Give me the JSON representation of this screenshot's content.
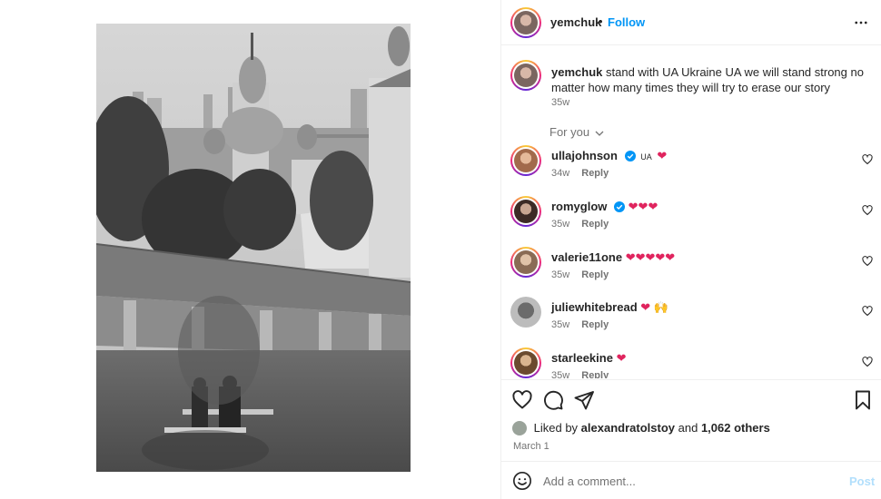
{
  "post": {
    "username": "yemchuk",
    "follow_label": "Follow",
    "dot": "•",
    "caption_user": "yemchuk",
    "caption_body": "stand with UA Ukraine UA we will stand strong no matter how many times they will try to erase our story",
    "caption_time": "35w"
  },
  "for_you_label": "For you",
  "comments": [
    {
      "user": "ullajohnson",
      "verified": true,
      "text_prefix": "UA",
      "hearts": "❤",
      "time": "34w",
      "reply": "Reply"
    },
    {
      "user": "romyglow",
      "verified": true,
      "text_prefix": "",
      "hearts": "❤❤❤",
      "time": "35w",
      "reply": "Reply"
    },
    {
      "user": "valerie11one",
      "verified": false,
      "text_prefix": "",
      "hearts": "❤❤❤❤❤",
      "time": "35w",
      "reply": "Reply"
    },
    {
      "user": "juliewhitebread",
      "verified": false,
      "text_prefix": "",
      "hearts": "❤",
      "extra_emoji": "🙌",
      "time": "35w",
      "reply": "Reply"
    },
    {
      "user": "starleekine",
      "verified": false,
      "text_prefix": "",
      "hearts": "❤",
      "time": "35w",
      "reply": "Reply"
    }
  ],
  "likes": {
    "prefix": "Liked by",
    "user": "alexandratolstoy",
    "joiner": "and",
    "others": "1,062 others"
  },
  "date": "March 1",
  "comment_box": {
    "placeholder": "Add a comment...",
    "post_label": "Post"
  },
  "icons": {
    "more": "more-horizontal-icon",
    "like": "heart-outline-icon",
    "comment": "speech-bubble-icon",
    "share": "paper-plane-icon",
    "save": "bookmark-icon",
    "emoji": "smiley-icon"
  },
  "colors": {
    "accent": "#0095f6",
    "text": "#262626",
    "muted": "#737373",
    "heart": "#e0245e",
    "verified": "#0095f6",
    "post_disabled": "#b2dffc"
  }
}
